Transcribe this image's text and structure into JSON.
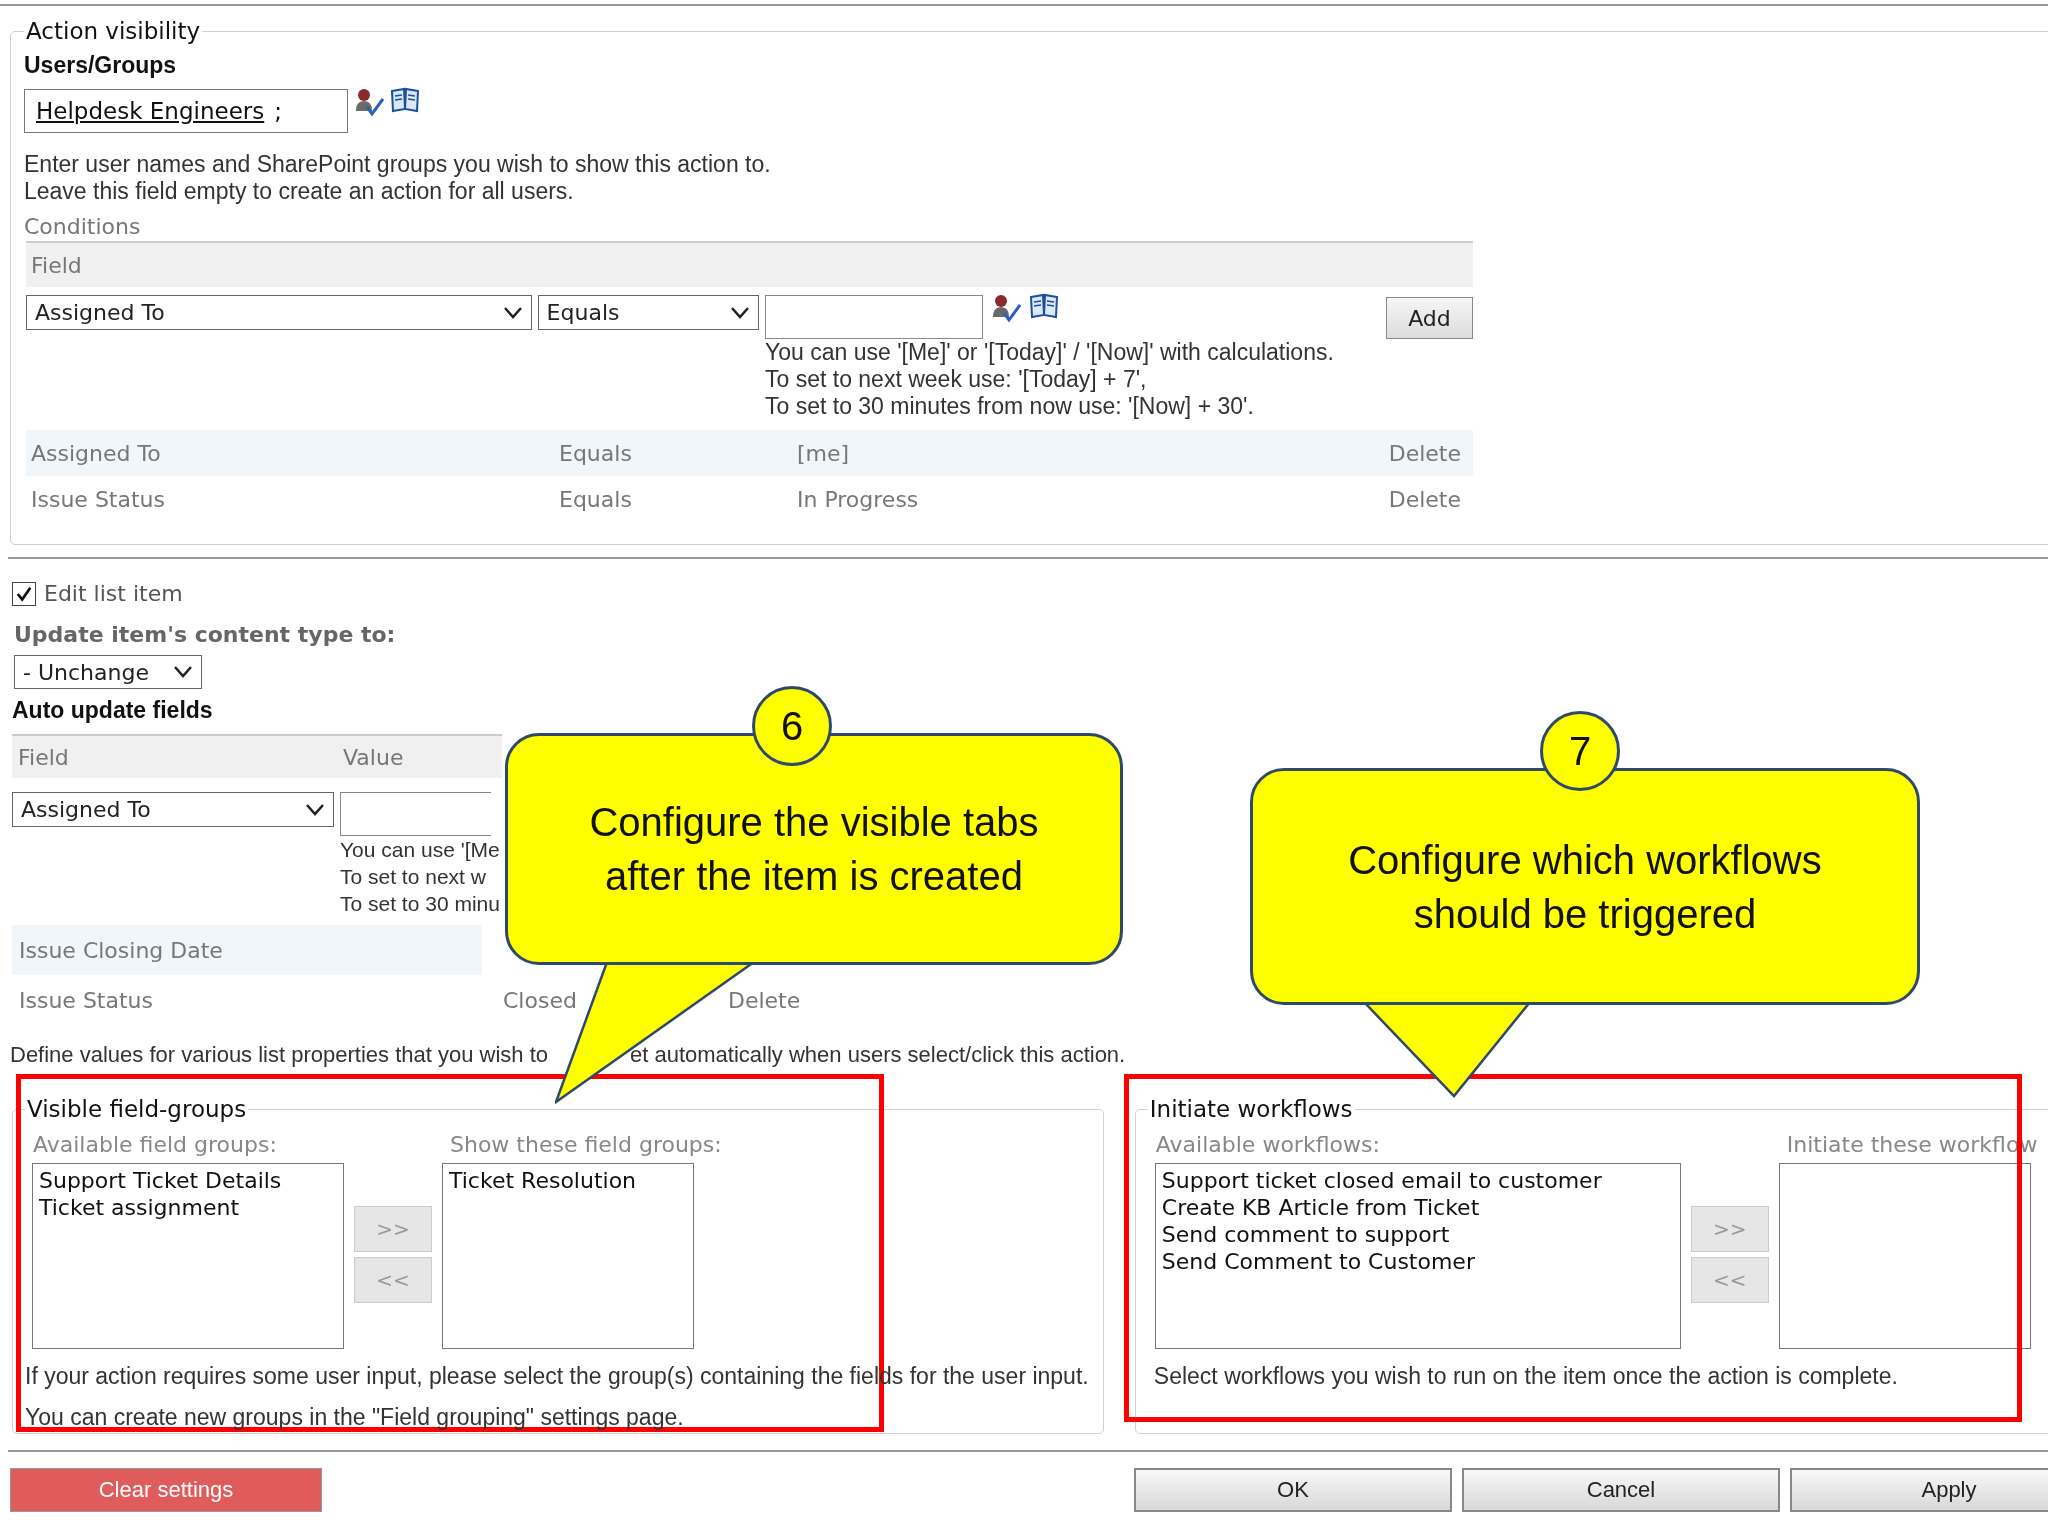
{
  "action_visibility": {
    "legend": "Action visibility",
    "users_label": "Users/Groups",
    "users_value": "Helpdesk Engineers",
    "users_separator": ";",
    "help": [
      "Enter user names and SharePoint groups you wish to show this action to.",
      "Leave this field empty to create an action for all users."
    ],
    "conditions": {
      "title": "Conditions",
      "columns": [
        "Field"
      ],
      "field_select": "Assigned To",
      "operator_select": "Equals",
      "add_button": "Add",
      "hints": [
        "You can use '[Me]' or '[Today]' / '[Now]' with calculations.",
        "To set to next week use: '[Today] + 7',",
        "To set to 30 minutes from now use: '[Now] + 30'."
      ],
      "rows": [
        {
          "field": "Assigned To",
          "operator": "Equals",
          "value": "[me]",
          "action": "Delete"
        },
        {
          "field": "Issue Status",
          "operator": "Equals",
          "value": "In Progress",
          "action": "Delete"
        }
      ]
    }
  },
  "edit_list_item": {
    "label": "Edit list item",
    "checked": true
  },
  "content_type": {
    "label": "Update item's content type to:",
    "value": "- Unchange"
  },
  "auto_update": {
    "title": "Auto update fields",
    "columns": [
      "Field",
      "Value"
    ],
    "field_select": "Assigned To",
    "hints": [
      "You can use '[Me",
      "To set to next w",
      "To set to 30 minu"
    ],
    "rows": [
      {
        "field": "Issue Closing Date"
      },
      {
        "field": "Issue Status",
        "value": "Closed",
        "action": "Delete"
      }
    ],
    "help": [
      "Define values for various list properties that you wish to",
      "et automatically when users select/click this action."
    ]
  },
  "field_groups": {
    "legend": "Visible field-groups",
    "available_label": "Available field groups:",
    "available": [
      "Support Ticket Details",
      "Ticket assignment"
    ],
    "chosen_label": "Show these field groups:",
    "chosen": [
      "Ticket Resolution"
    ],
    "add_button": ">>",
    "remove_button": "<<",
    "help": [
      "If your action requires some user input, please select the group(s) containing the fields for the user input.",
      "You can create new groups in the \"Field grouping\" settings page."
    ]
  },
  "workflows": {
    "legend": "Initiate workflows",
    "available_label": "Available workflows:",
    "available": [
      "Support ticket closed email to customer",
      "Create KB Article from Ticket",
      "Send comment to support",
      "Send Comment to Customer"
    ],
    "chosen_label": "Initiate these workflow",
    "add_button": ">>",
    "remove_button": "<<",
    "help": [
      "Select workflows you wish to run on the item once the action is complete."
    ]
  },
  "buttons": {
    "clear": "Clear settings",
    "ok": "OK",
    "cancel": "Cancel",
    "apply": "Apply"
  },
  "callouts": [
    {
      "number": "6",
      "text": "Configure the visible tabs\nafter the item is created"
    },
    {
      "number": "7",
      "text": "Configure which workflows\nshould be triggered"
    }
  ]
}
